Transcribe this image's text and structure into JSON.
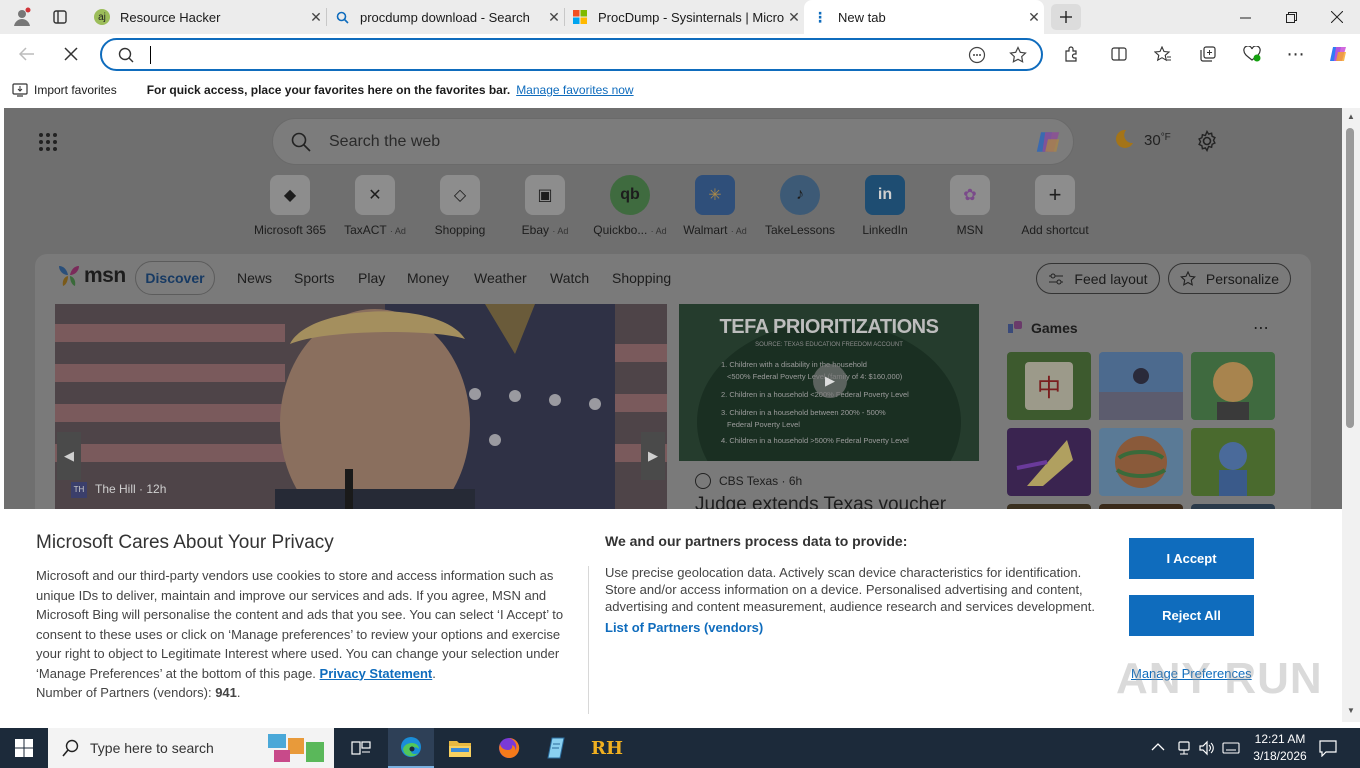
{
  "tabs": [
    {
      "title": "Resource Hacker",
      "icon": "resource-hacker-icon",
      "close": "✕"
    },
    {
      "title": "procdump download - Search",
      "icon": "search-icon",
      "close": "✕"
    },
    {
      "title": "ProcDump - Sysinternals | Micros",
      "icon": "microsoft-logo-icon",
      "close": "✕"
    },
    {
      "title": "New tab",
      "icon": "newtab-icon",
      "close": "✕"
    }
  ],
  "address": {
    "value": "",
    "placeholder": ""
  },
  "favorites_bar": {
    "import_label": "Import favorites",
    "hint": "For quick access, place your favorites here on the favorites bar.",
    "manage_link": "Manage favorites now"
  },
  "newtab": {
    "search_placeholder": "Search the web",
    "weather": "30",
    "weather_unit": "°F",
    "shortcuts": [
      {
        "label": "Microsoft 365",
        "ad": "",
        "glyph": "◆"
      },
      {
        "label": "TaxACT",
        "ad": "· Ad",
        "glyph": "✕"
      },
      {
        "label": "Shopping",
        "ad": "",
        "glyph": "◇"
      },
      {
        "label": "Ebay",
        "ad": "· Ad",
        "glyph": "▣"
      },
      {
        "label": "Quickbo...",
        "ad": "· Ad",
        "glyph": "qb"
      },
      {
        "label": "Walmart",
        "ad": "· Ad",
        "glyph": "✳"
      },
      {
        "label": "TakeLessons",
        "ad": "",
        "glyph": "♪"
      },
      {
        "label": "LinkedIn",
        "ad": "",
        "glyph": "in"
      },
      {
        "label": "MSN",
        "ad": "",
        "glyph": "✿"
      },
      {
        "label": "Add shortcut",
        "ad": "",
        "glyph": "+"
      }
    ]
  },
  "msn": {
    "brand": "msn",
    "nav": [
      "Discover",
      "News",
      "Sports",
      "Play",
      "Money",
      "Weather",
      "Watch",
      "Shopping"
    ],
    "feed_layout": "Feed layout",
    "personalize": "Personalize",
    "card1": {
      "source": "The Hill",
      "age": "· 12h"
    },
    "card2": {
      "source": "CBS Texas",
      "age": "· 6h",
      "headline": "Judge extends Texas voucher",
      "image_title": "TEFA PRIORITIZATIONS",
      "image_subtitle": "SOURCE: TEXAS EDUCATION FREEDOM ACCOUNT",
      "image_lines": [
        "1. Children with a disability in the household",
        "<500% Federal Poverty Level (family of 4: $160,000)",
        "2. Children in a household <200% Federal Poverty Level",
        "3. Children in a household between 200% - 500%",
        "Federal Poverty Level",
        "4. Children in a household >500% Federal Poverty Level"
      ]
    },
    "games_title": "Games"
  },
  "consent": {
    "title": "Microsoft Cares About Your Privacy",
    "body": "Microsoft and our third-party vendors use cookies to store and access information such as unique IDs to deliver, maintain and improve our services and ads. If you agree, MSN and Microsoft Bing will personalise the content and ads that you see. You can select ‘I Accept’ to consent to these uses or click on ‘Manage preferences’ to review your options and exercise your right to object to Legitimate Interest where used.  You can change your selection under ‘Manage Preferences’ at the bottom of this page.",
    "privacy_link": "Privacy Statement",
    "partners_label": "Number of Partners (vendors):",
    "partners_count": "941",
    "right_title": "We and our partners process data to provide:",
    "right_body": "Use precise geolocation data. Actively scan device characteristics for identification. Store and/or access information on a device. Personalised advertising and content, advertising and content measurement, audience research and services development.",
    "partners_link": "List of Partners (vendors)",
    "accept": "I Accept",
    "reject": "Reject All",
    "manage": "Manage Preferences"
  },
  "watermark": "ANY RUN",
  "taskbar": {
    "search_placeholder": "Type here to search",
    "time": "12:21 AM",
    "date": "3/18/2026",
    "rh_label": "RH"
  },
  "colors": {
    "accent": "#0f6cbd",
    "taskbar": "#1c2a3a"
  }
}
